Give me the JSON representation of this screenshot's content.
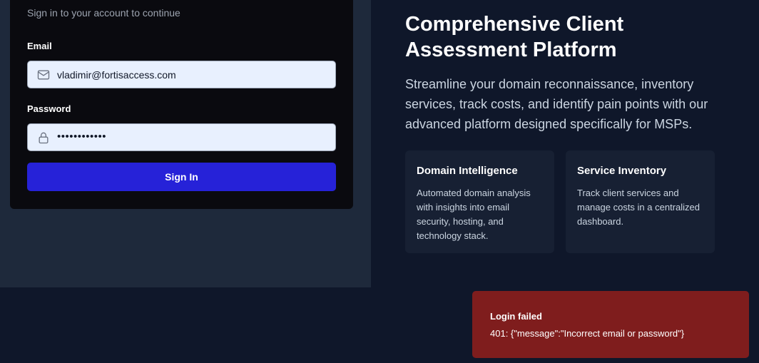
{
  "login": {
    "subtitle": "Sign in to your account to continue",
    "email_label": "Email",
    "email_value": "vladimir@fortisaccess.com",
    "password_label": "Password",
    "password_value": "••••••••••••",
    "signin_label": "Sign In"
  },
  "hero": {
    "title": "Comprehensive Client Assessment Platform",
    "description": "Streamline your domain reconnaissance, inventory services, track costs, and identify pain points with our advanced platform designed specifically for MSPs.",
    "features": [
      {
        "title": "Domain Intelligence",
        "text": "Automated domain analysis with insights into email security, hosting, and technology stack."
      },
      {
        "title": "Service Inventory",
        "text": "Track client services and manage costs in a centralized dashboard."
      }
    ]
  },
  "toast": {
    "title": "Login failed",
    "message": "401: {\"message\":\"Incorrect email or password\"}"
  },
  "colors": {
    "primary_button": "#2622d8",
    "error_toast": "#7f1d1d",
    "input_bg": "#e8f0fe"
  },
  "icons": {
    "email": "mail-icon",
    "password": "lock-icon"
  }
}
